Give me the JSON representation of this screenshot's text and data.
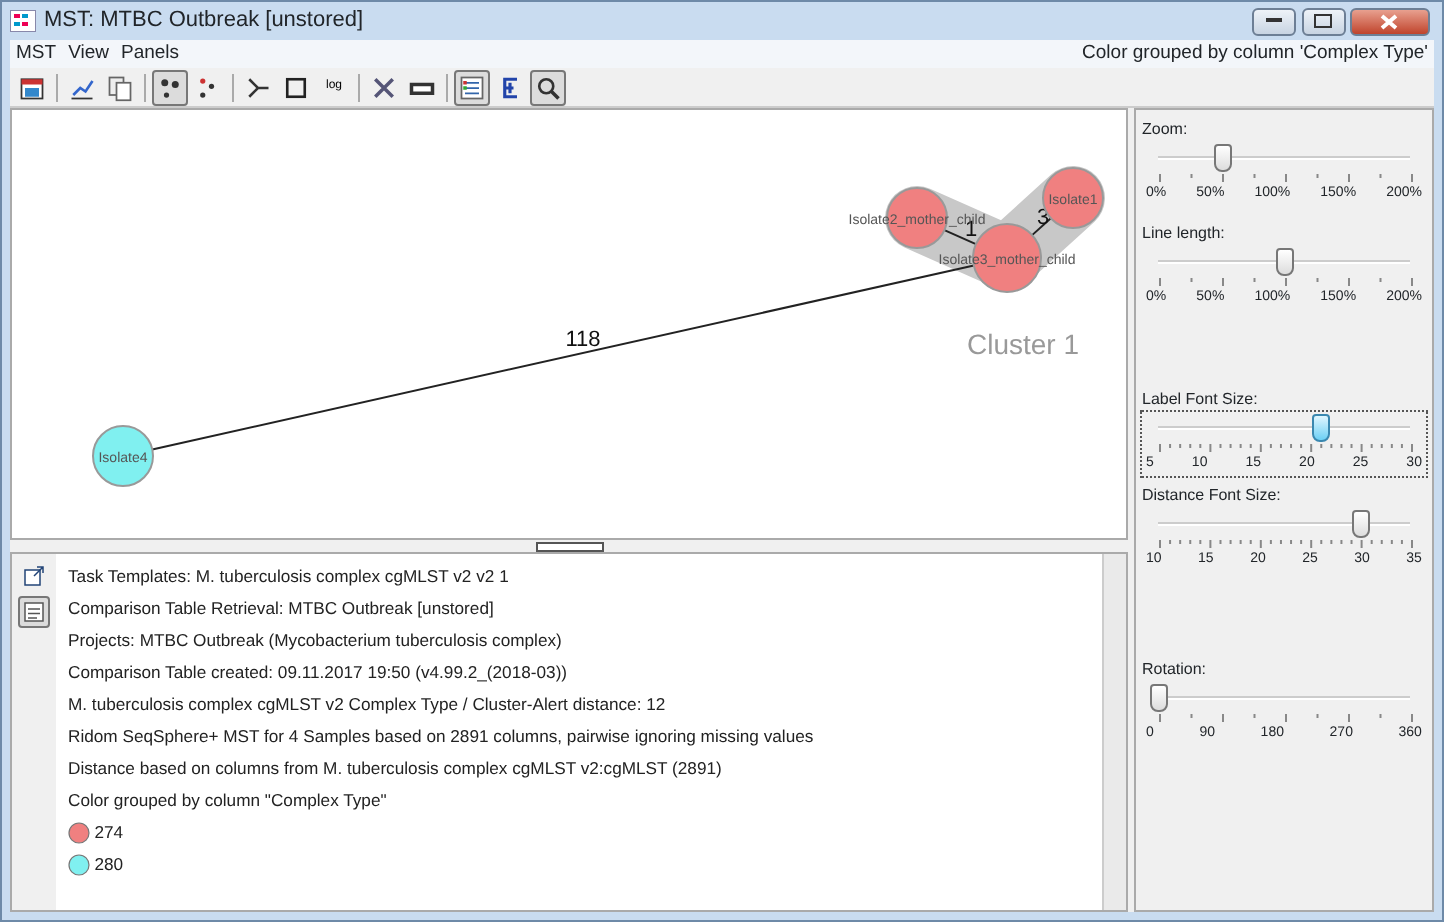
{
  "window": {
    "title": "MST: MTBC Outbreak [unstored]"
  },
  "menu": [
    "MST",
    "View",
    "Panels"
  ],
  "status_text": "Color grouped by column 'Complex Type'",
  "toolbar": [
    {
      "kind": "calendar",
      "selected": false
    },
    {
      "kind": "chart",
      "selected": false
    },
    {
      "kind": "copy",
      "selected": false
    },
    {
      "kind": "graph",
      "selected": true
    },
    {
      "kind": "dots",
      "selected": false
    },
    {
      "kind": "split",
      "selected": false
    },
    {
      "kind": "square",
      "selected": false
    },
    {
      "kind": "log",
      "label": "log",
      "selected": false
    },
    {
      "kind": "tools",
      "selected": false
    },
    {
      "kind": "counter",
      "selected": false
    },
    {
      "kind": "list",
      "selected": true
    },
    {
      "kind": "tree",
      "selected": false
    },
    {
      "kind": "search",
      "selected": true
    }
  ],
  "graph": {
    "nodes": [
      {
        "label": "Isolate1",
        "color": "#f08080"
      },
      {
        "label": "Isolate2_mother_child",
        "color": "#f08080"
      },
      {
        "label": "Isolate3_mother_child",
        "color": "#f08080"
      },
      {
        "label": "Isolate4",
        "color": "#80f0f0"
      }
    ],
    "edges": [
      {
        "label": "3"
      },
      {
        "label": "1"
      },
      {
        "label": "118"
      }
    ],
    "cluster_label": "Cluster 1"
  },
  "info_tools": [
    {
      "kind": "export",
      "selected": false
    },
    {
      "kind": "text",
      "selected": true
    }
  ],
  "info_lines": [
    "Task Templates: M. tuberculosis complex cgMLST v2 v2 1",
    "Comparison Table Retrieval: MTBC Outbreak [unstored]",
    "Projects: MTBC Outbreak (Mycobacterium tuberculosis complex)",
    "Comparison Table created: 09.11.2017 19:50 (v4.99.2_(2018-03))",
    "M. tuberculosis complex cgMLST v2 Complex Type / Cluster-Alert distance: 12",
    "Ridom SeqSphere+ MST for 4 Samples based on 2891 columns, pairwise ignoring missing values",
    "Distance based on columns from M. tuberculosis complex cgMLST v2:cgMLST (2891)",
    "Color grouped by column \"Complex Type\""
  ],
  "legend": [
    {
      "label": "274",
      "color": "#f08080"
    },
    {
      "label": "280",
      "color": "#80f0f0"
    }
  ],
  "sliders": [
    {
      "label": "Zoom:",
      "level": 0.25,
      "ticks": [
        "0%",
        "50%",
        "100%",
        "150%",
        "200%"
      ],
      "focused": false,
      "minor": false
    },
    {
      "label": "Line length:",
      "level": 0.5,
      "ticks": [
        "0%",
        "50%",
        "100%",
        "150%",
        "200%"
      ],
      "focused": false,
      "minor": false
    },
    {
      "label": "Label Font Size:",
      "level": 0.64,
      "ticks": [
        "5",
        "10",
        "15",
        "20",
        "25",
        "30"
      ],
      "focused": true,
      "minor": true
    },
    {
      "label": "Distance Font Size:",
      "level": 0.8,
      "ticks": [
        "10",
        "15",
        "20",
        "25",
        "30",
        "35"
      ],
      "focused": false,
      "minor": true
    },
    {
      "label": "Rotation:",
      "level": 0,
      "ticks": [
        "0",
        "90",
        "180",
        "270",
        "360"
      ],
      "focused": false,
      "minor": false
    }
  ]
}
